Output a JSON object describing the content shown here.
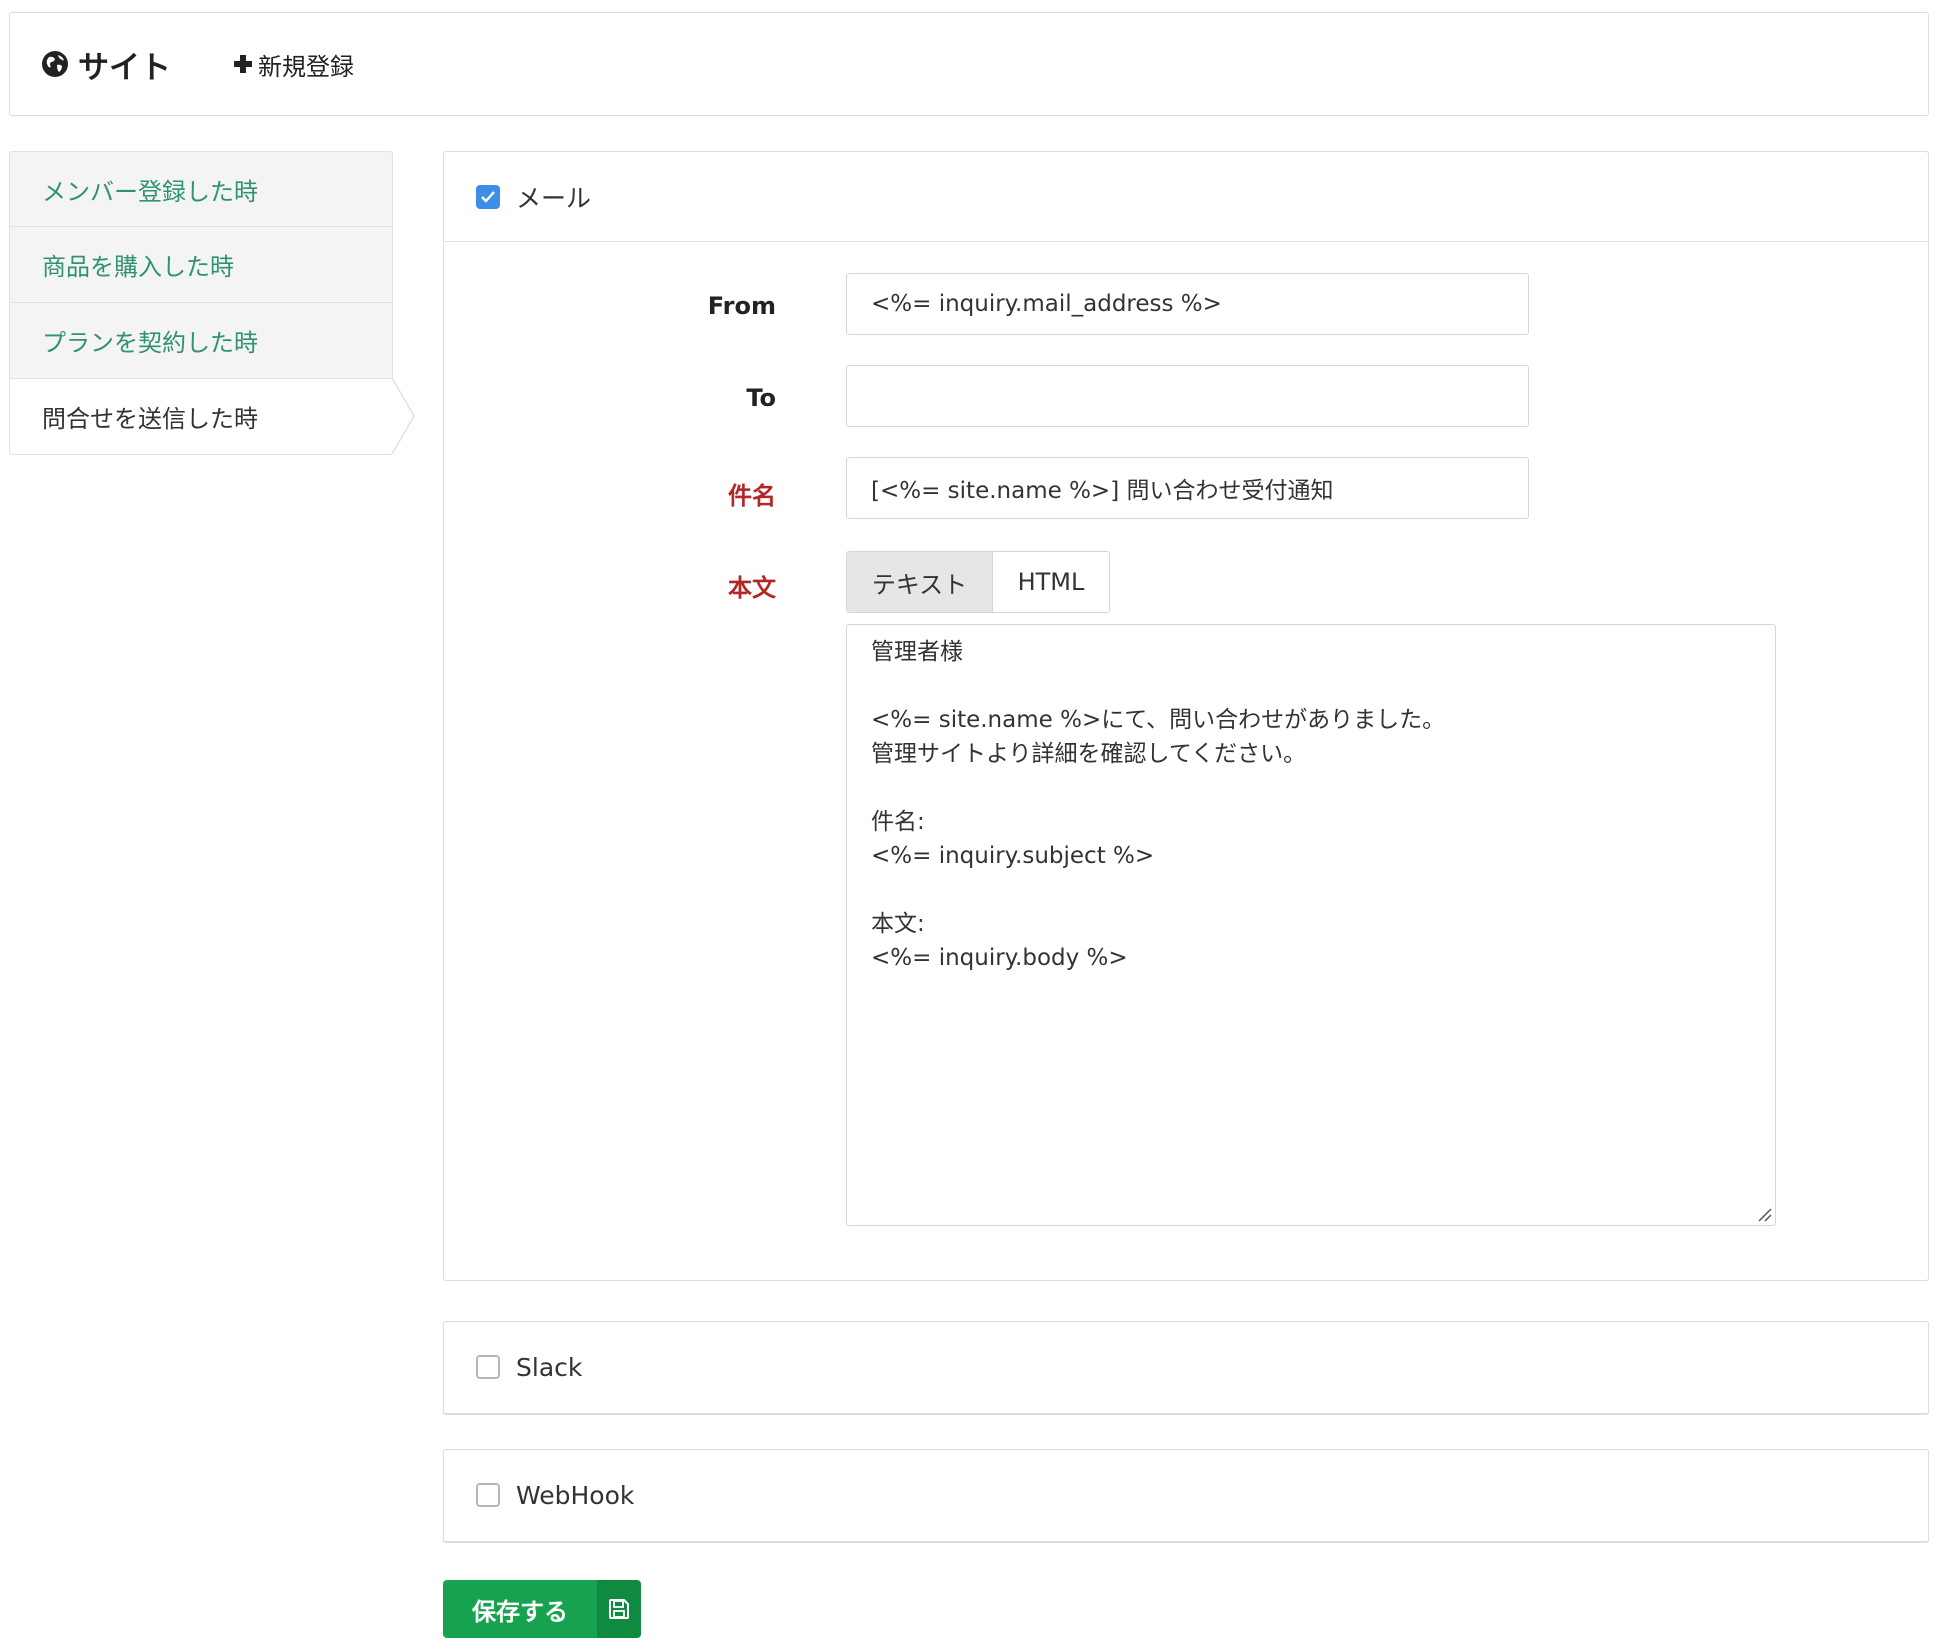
{
  "header": {
    "brand_label": "サイト",
    "new_label": "新規登録"
  },
  "sidebar": {
    "items": [
      {
        "label": "メンバー登録した時",
        "active": false
      },
      {
        "label": "商品を購入した時",
        "active": false
      },
      {
        "label": "プランを契約した時",
        "active": false
      },
      {
        "label": "問合せを送信した時",
        "active": true
      }
    ]
  },
  "mail": {
    "enable_label": "メール",
    "enabled": true,
    "from_label": "From",
    "from_value": "<%= inquiry.mail_address %>",
    "to_label": "To",
    "to_value": "",
    "subject_label": "件名",
    "subject_value": "[<%= site.name %>] 問い合わせ受付通知",
    "body_label": "本文",
    "tabs": [
      {
        "label": "テキスト",
        "active": true
      },
      {
        "label": "HTML",
        "active": false
      }
    ],
    "body_lines": [
      "管理者様",
      "",
      "<%= site.name %>にて、問い合わせがありました。",
      "管理サイトより詳細を確認してください。",
      "",
      "件名:",
      "<%= inquiry.subject %>",
      "",
      "本文:",
      "<%= inquiry.body %>"
    ]
  },
  "slack": {
    "label": "Slack",
    "enabled": false
  },
  "webhook": {
    "label": "WebHook",
    "enabled": false
  },
  "save": {
    "label": "保存する"
  },
  "colors": {
    "link": "#2f9272",
    "required": "#b32626",
    "checkbox_checked": "#3d8ee6",
    "save_button": "#17a24f",
    "save_icon_bg": "#0f8a40"
  }
}
